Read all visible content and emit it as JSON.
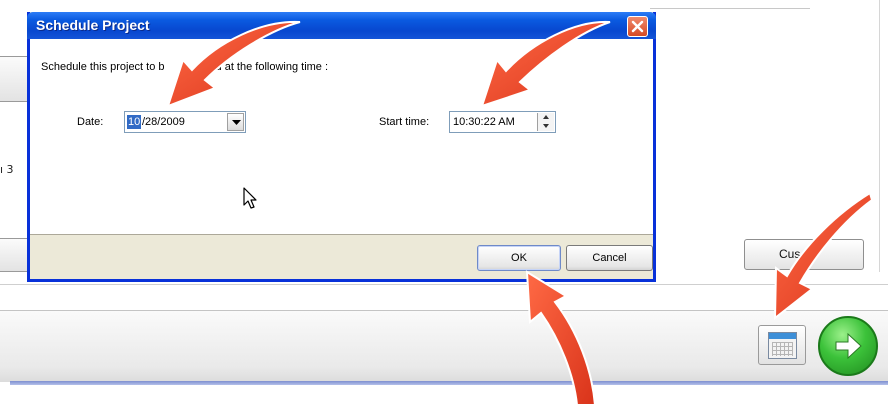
{
  "dialog": {
    "title": "Schedule Project",
    "prompt_start": "Schedule this project to b",
    "prompt_end": "d at the following time :",
    "date_label": "Date:",
    "date_selected": "10",
    "date_rest": "/28/2009",
    "start_time_label": "Start time:",
    "start_time_value": "10:30:22 AM",
    "ok_label": "OK",
    "cancel_label": "Cancel"
  },
  "background": {
    "left_fragment": "ı 3",
    "customize_button": "Cus"
  },
  "icons": {
    "close": "close-icon",
    "dropdown": "chevron-down-icon",
    "spin_up": "spin-up-icon",
    "spin_down": "spin-down-icon",
    "calendar": "calendar-icon",
    "next": "arrow-right-icon",
    "cursor": "mouse-pointer-icon",
    "annotation": "red-arrow-icon"
  },
  "colors": {
    "title_bar": "#0a5ae0",
    "close_button": "#d64a24",
    "selection": "#316ac5",
    "next_button": "#3cc23a",
    "annotation_arrow": "#e8472a"
  }
}
